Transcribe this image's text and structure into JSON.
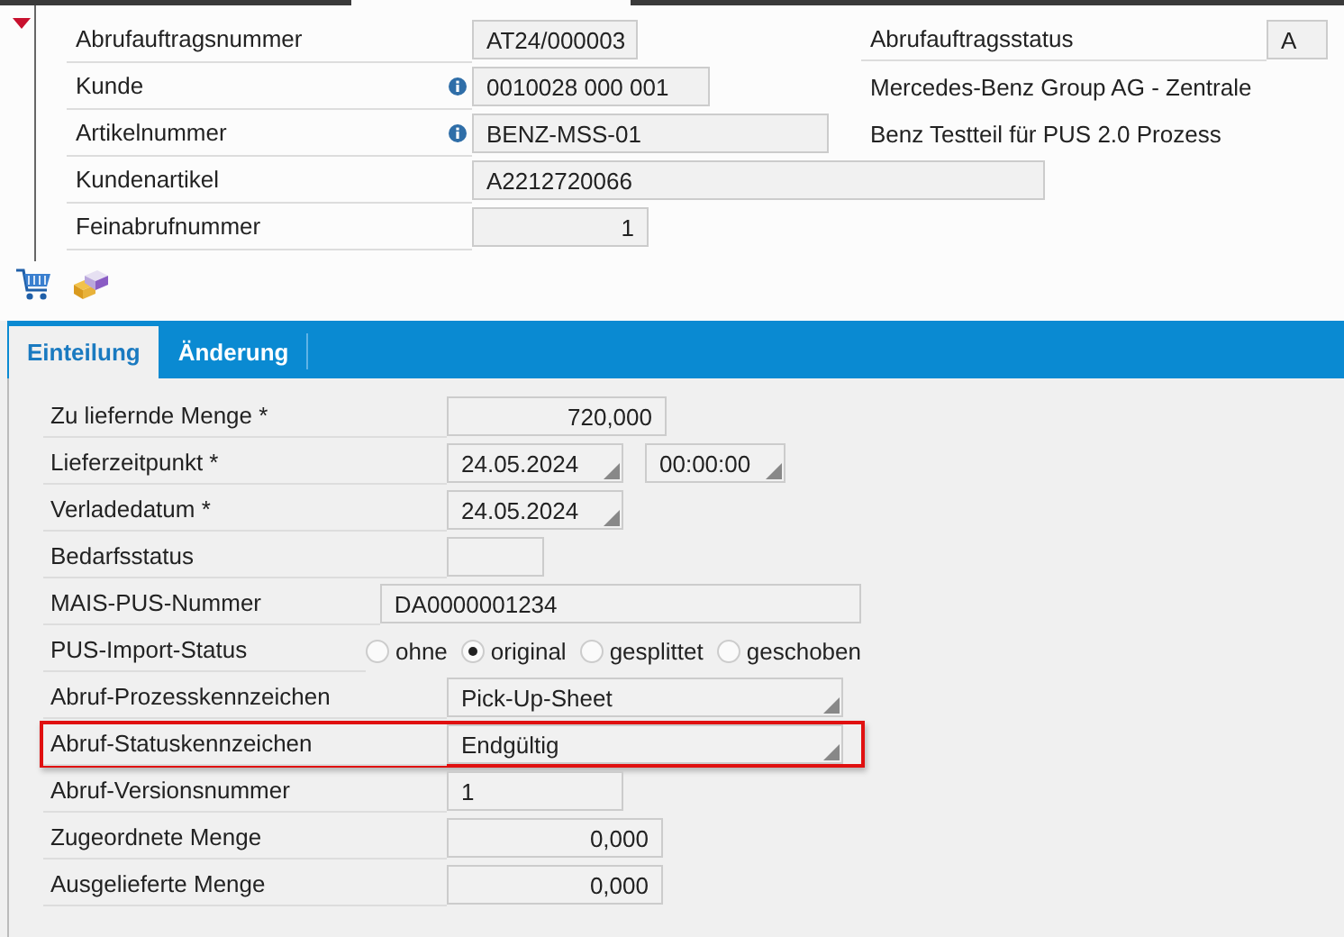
{
  "header": {
    "collapsed": false,
    "rows": [
      {
        "kind": "text",
        "label": "Abrufauftragsnummer",
        "info": false,
        "value": "AT24/000003",
        "side": {
          "kind": "field",
          "label": "Abrufauftragsstatus",
          "value": "A"
        }
      },
      {
        "kind": "text",
        "label": "Kunde",
        "info": true,
        "value": "0010028 000 001",
        "side": {
          "kind": "text",
          "value": "Mercedes-Benz Group AG - Zentrale"
        }
      },
      {
        "kind": "text",
        "label": "Artikelnummer",
        "info": true,
        "value": "BENZ-MSS-01",
        "side": {
          "kind": "text",
          "value": "Benz Testteil für PUS 2.0 Prozess"
        }
      },
      {
        "kind": "text",
        "label": "Kundenartikel",
        "info": false,
        "value": "A2212720066"
      },
      {
        "kind": "number",
        "label": "Feinabrufnummer",
        "info": false,
        "value": "1"
      }
    ]
  },
  "toolbar": [
    {
      "kind": "cart"
    },
    {
      "kind": "boxes"
    }
  ],
  "tabs": [
    {
      "label": "Einteilung",
      "selected": true
    },
    {
      "label": "Änderung",
      "selected": false
    }
  ],
  "form": [
    {
      "kind": "number",
      "label": "Zu liefernde Menge *",
      "value": "720,000",
      "highlighted": false
    },
    {
      "kind": "datetime",
      "label": "Lieferzeitpunkt *",
      "value": "24.05.2024",
      "time": "00:00:00",
      "highlighted": false
    },
    {
      "kind": "date",
      "label": "Verladedatum *",
      "value": "24.05.2024",
      "highlighted": false
    },
    {
      "kind": "text",
      "label": "Bedarfsstatus",
      "highlighted": false
    },
    {
      "kind": "text",
      "label": "MAIS-PUS-Nummer",
      "value": "DA0000001234",
      "highlighted": false
    },
    {
      "kind": "radio",
      "label": "PUS-Import-Status",
      "options": [
        {
          "label": "ohne",
          "selected": false
        },
        {
          "label": "original",
          "selected": true
        },
        {
          "label": "gesplittet",
          "selected": false
        },
        {
          "label": "geschoben",
          "selected": false
        }
      ],
      "highlighted": false
    },
    {
      "kind": "dropdown",
      "label": "Abruf-Prozesskennzeichen",
      "value": "Pick-Up-Sheet",
      "highlighted": false
    },
    {
      "kind": "dropdown",
      "label": "Abruf-Statuskennzeichen",
      "value": "Endgültig",
      "highlighted": true
    },
    {
      "kind": "text",
      "label": "Abruf-Versionsnummer",
      "value": "1",
      "highlighted": false
    },
    {
      "kind": "number",
      "label": "Zugeordnete Menge",
      "value": "0,000",
      "highlighted": false
    },
    {
      "kind": "number",
      "label": "Ausgelieferte Menge",
      "value": "0,000",
      "highlighted": false
    }
  ]
}
